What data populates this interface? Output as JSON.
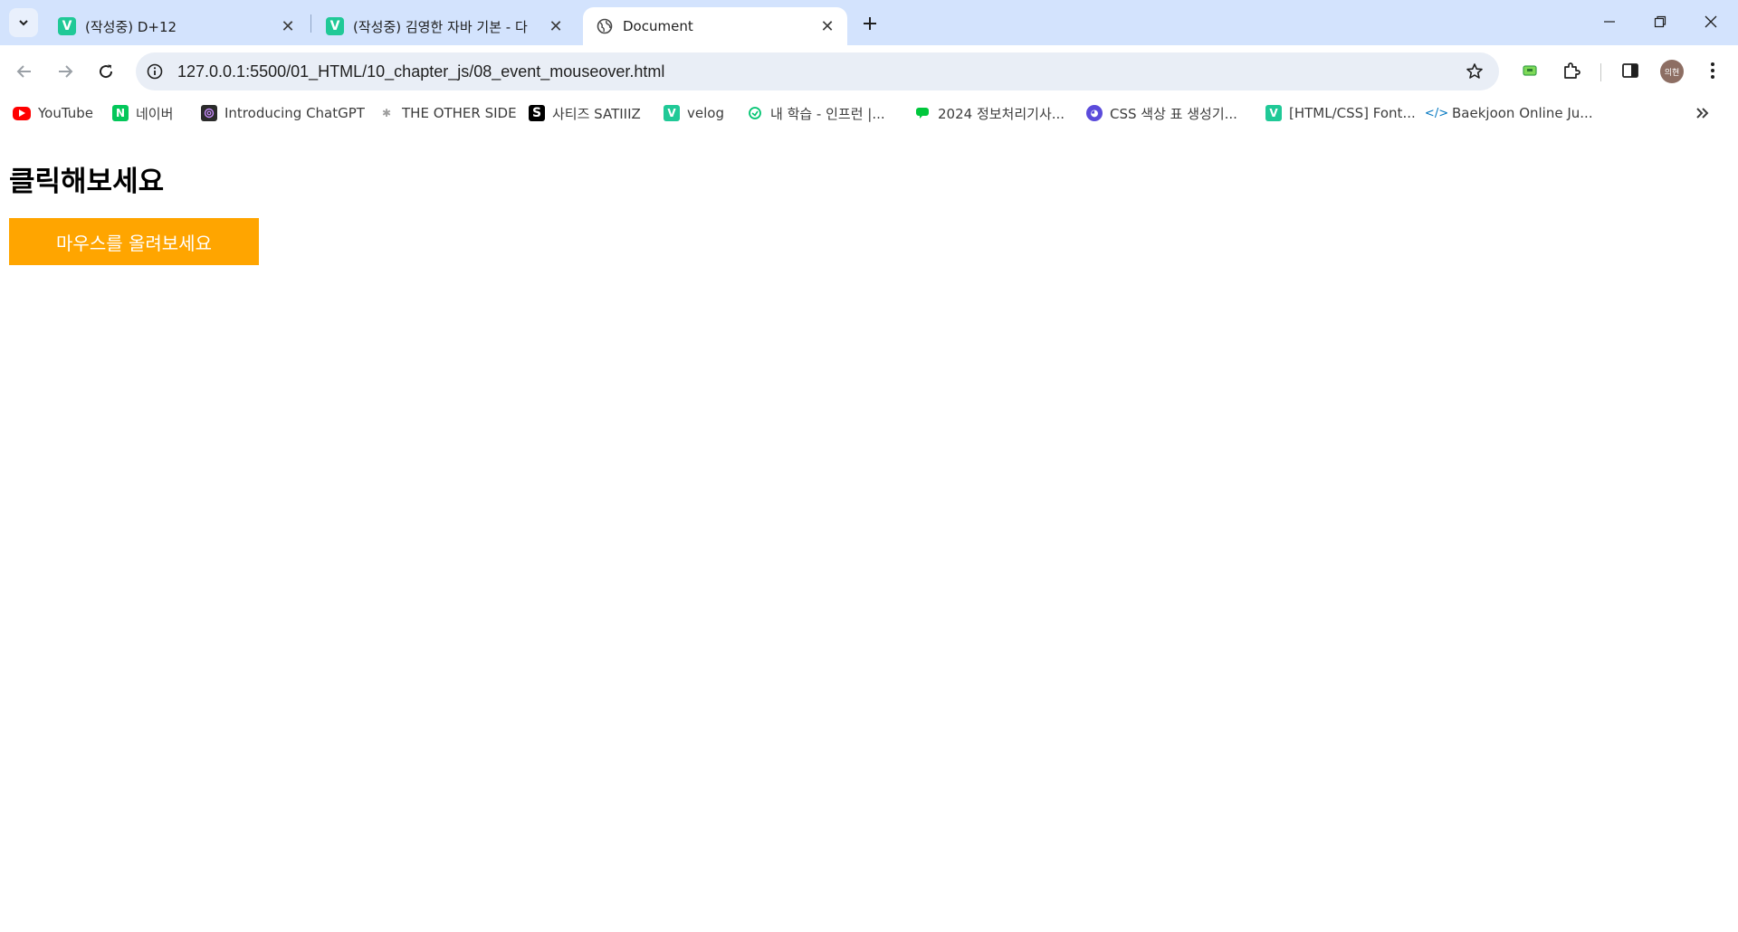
{
  "tabs": [
    {
      "title": "(작성중) D+12",
      "favicon": "V",
      "active": false
    },
    {
      "title": "(작성중) 김영한 자바 기본 - 다",
      "favicon": "V",
      "active": false
    },
    {
      "title": "Document",
      "favicon": "globe",
      "active": true
    }
  ],
  "toolbar": {
    "url": "127.0.0.1:5500/01_HTML/10_chapter_js/08_event_mouseover.html",
    "avatar_text": "의현"
  },
  "bookmarks": [
    {
      "label": "YouTube",
      "icon": "youtube-icon",
      "color": "#ff0000"
    },
    {
      "label": "네이버",
      "icon": "naver-icon",
      "color": "#03c75a"
    },
    {
      "label": "Introducing ChatGPT",
      "icon": "openai-icon",
      "color": "#2b2b2b"
    },
    {
      "label": "THE OTHER SIDE",
      "icon": "bug-icon",
      "color": "#9e9e9e"
    },
    {
      "label": "사티즈 SATIIIZ",
      "icon": "s-logo-icon",
      "color": "#000000"
    },
    {
      "label": "velog",
      "icon": "velog-icon",
      "color": "#20c997"
    },
    {
      "label": "내 학습 - 인프런 |...",
      "icon": "inflearn-icon",
      "color": "#00c471"
    },
    {
      "label": "2024 정보처리기사...",
      "icon": "chat-icon",
      "color": "#00c73c"
    },
    {
      "label": "CSS 색상 표 생성기...",
      "icon": "mask-icon",
      "color": "#5b4bdb"
    },
    {
      "label": "[HTML/CSS] Font...",
      "icon": "velog-icon",
      "color": "#20c997"
    },
    {
      "label": "Baekjoon Online Ju...",
      "icon": "code-icon",
      "color": "#0076c0"
    }
  ],
  "page": {
    "heading": "클릭해보세요",
    "button_label": "마우스를 올려보세요",
    "button_color": "#ffa500"
  }
}
